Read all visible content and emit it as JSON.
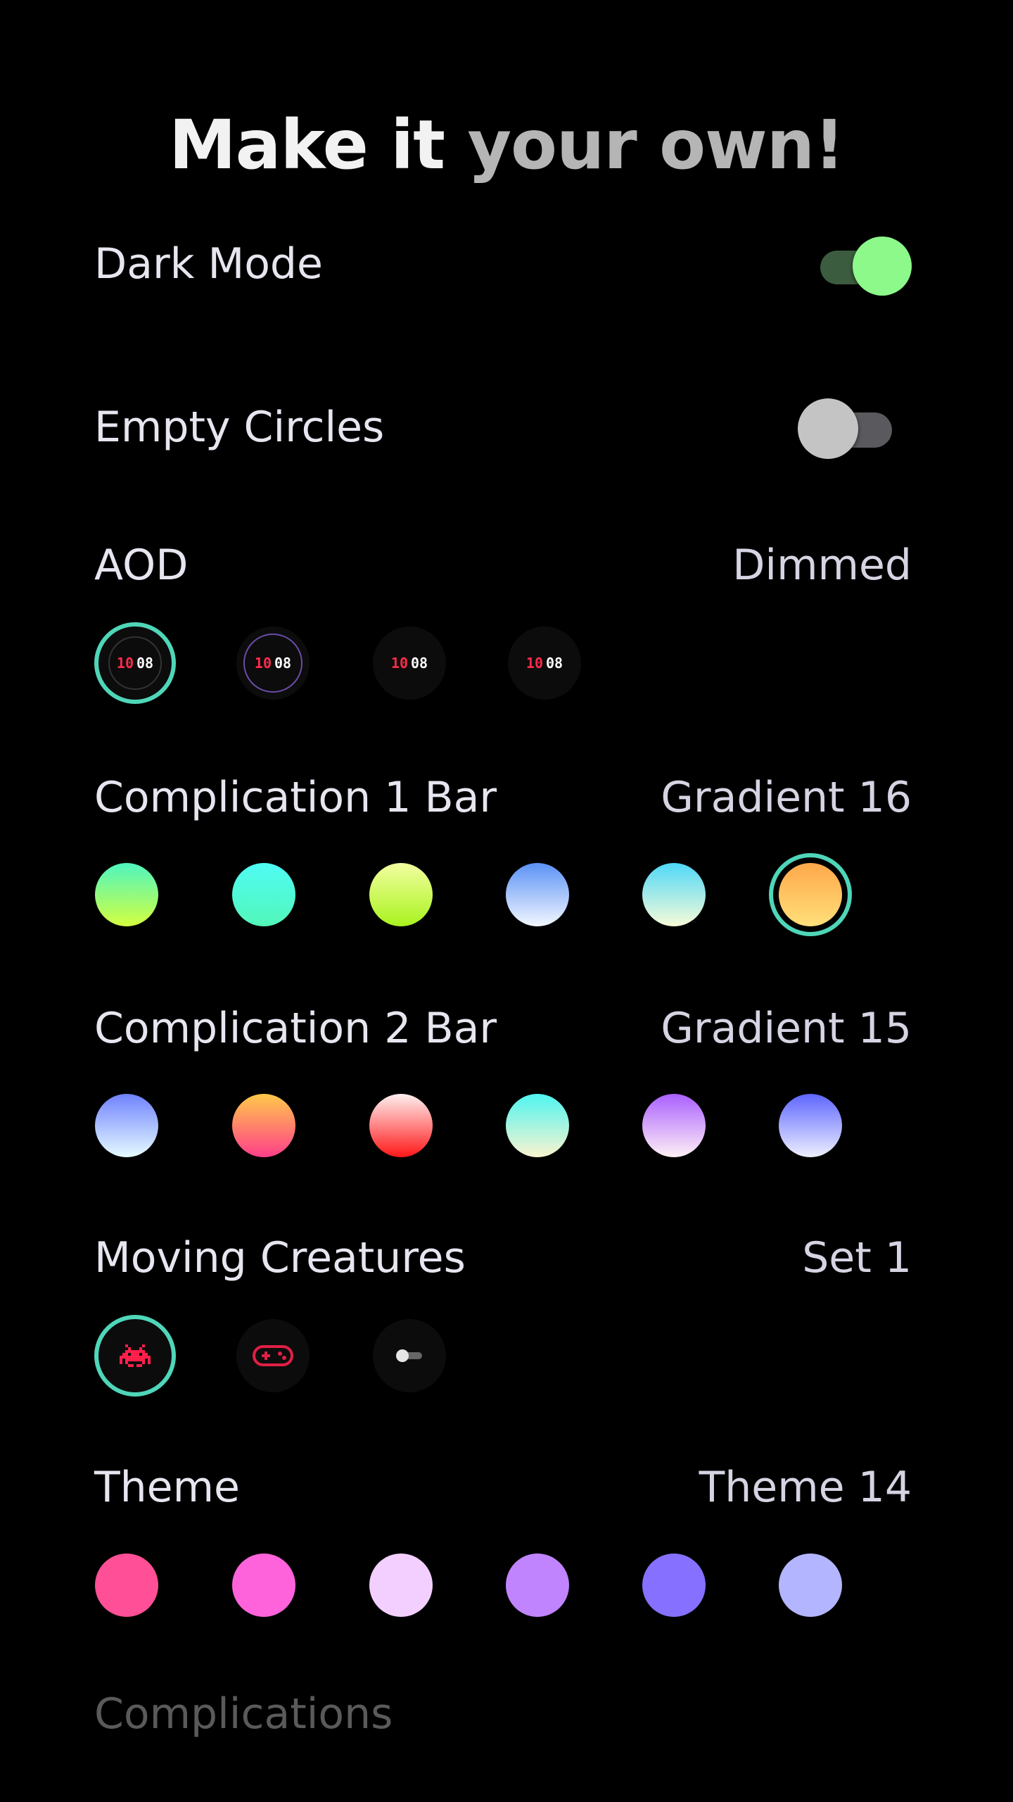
{
  "title": {
    "part1": "Make it",
    "part2": "your own!"
  },
  "dark_mode": {
    "label": "Dark Mode",
    "on": true
  },
  "empty_circles": {
    "label": "Empty Circles",
    "on": false
  },
  "aod": {
    "label": "AOD",
    "value": "Dimmed",
    "options": [
      {
        "icon": "aod-full-preview-icon",
        "hour": "10",
        "minute": "08",
        "selected": true
      },
      {
        "icon": "aod-ring-preview-icon",
        "hour": "10",
        "minute": "08",
        "selected": false
      },
      {
        "icon": "aod-minimal-preview-icon",
        "hour": "10",
        "minute": "08",
        "selected": false
      },
      {
        "icon": "aod-digits-only-icon",
        "hour": "10",
        "minute": "08",
        "selected": false
      }
    ]
  },
  "complication1": {
    "label": "Complication 1 Bar",
    "value": "Gradient 16",
    "swatches": [
      {
        "top": "#4ff5c0",
        "bottom": "#d4ff3f",
        "selected": false
      },
      {
        "top": "#4ffcf5",
        "bottom": "#52f7b8",
        "selected": false
      },
      {
        "top": "#f3ffa0",
        "bottom": "#a8f21e",
        "selected": false
      },
      {
        "top": "#5b92f5",
        "bottom": "#f3f7ff",
        "selected": false
      },
      {
        "top": "#4fd8f8",
        "bottom": "#f8fbd8",
        "selected": false
      },
      {
        "top": "#ffa84a",
        "bottom": "#ffe07a",
        "selected": true
      }
    ]
  },
  "complication2": {
    "label": "Complication 2 Bar",
    "value": "Gradient 15",
    "swatches": [
      {
        "top": "#6f82ff",
        "bottom": "#e6fbff",
        "selected": false
      },
      {
        "top": "#ffc94a",
        "bottom": "#ff3f8a",
        "selected": false
      },
      {
        "top": "#fff0f0",
        "bottom": "#ff1717",
        "selected": false
      },
      {
        "top": "#4ff5f0",
        "bottom": "#fbf4d0",
        "selected": false
      },
      {
        "top": "#a960ff",
        "bottom": "#fff0f5",
        "selected": false
      },
      {
        "top": "#5e66ff",
        "bottom": "#eef0ff",
        "selected": false
      }
    ]
  },
  "creatures": {
    "label": "Moving Creatures",
    "value": "Set 1",
    "options": [
      {
        "icon": "space-invader-icon",
        "selected": true
      },
      {
        "icon": "gamepad-icon",
        "selected": false
      },
      {
        "icon": "toggle-off-icon",
        "selected": false
      }
    ]
  },
  "theme": {
    "label": "Theme",
    "value": "Theme 14",
    "swatches": [
      {
        "color": "#ff4f96",
        "selected": false
      },
      {
        "color": "#ff63db",
        "selected": false
      },
      {
        "color": "#f3cfff",
        "selected": false
      },
      {
        "color": "#c184ff",
        "selected": false
      },
      {
        "color": "#8670ff",
        "selected": false
      },
      {
        "color": "#b3b5ff",
        "selected": false
      }
    ]
  },
  "complications_section": {
    "label": "Complications"
  }
}
